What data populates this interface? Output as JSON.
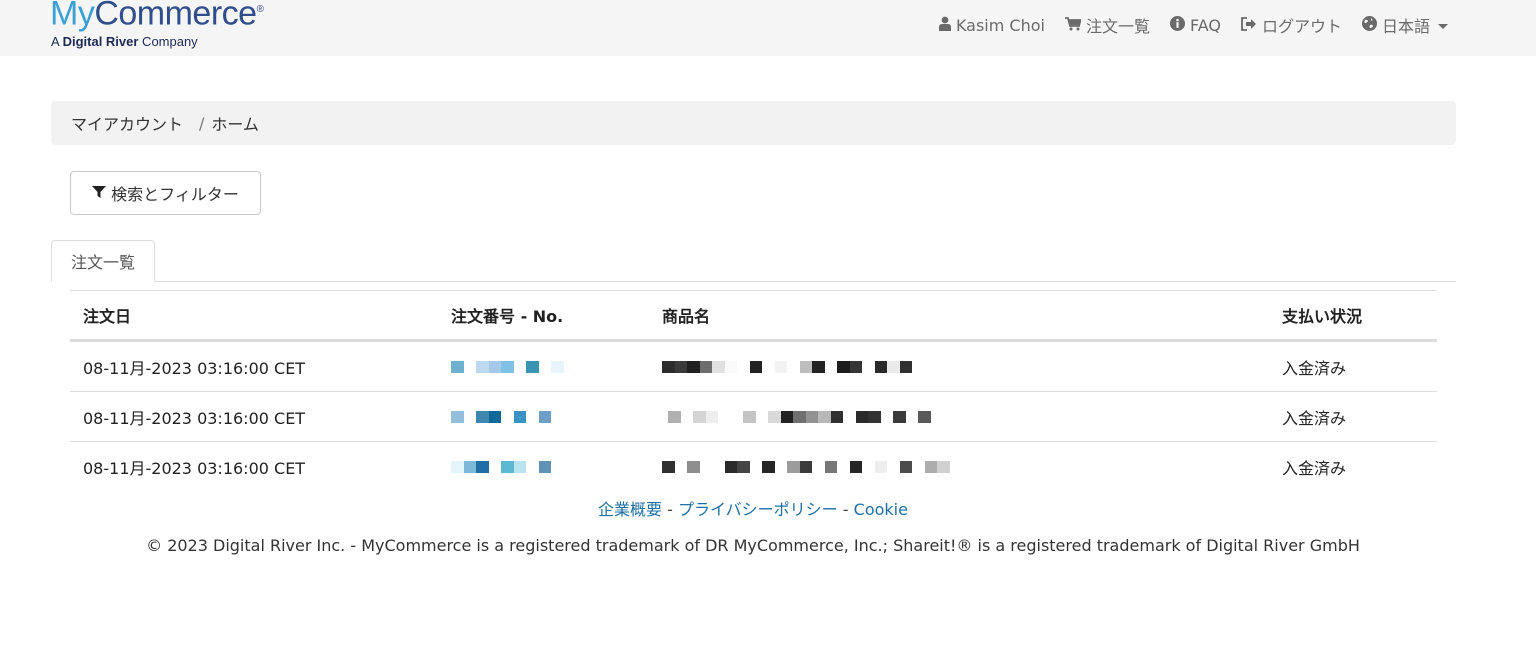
{
  "brand": {
    "logo_my": "My",
    "logo_commerce": "Commerce",
    "logo_reg": "®",
    "tagline_prefix": "A ",
    "tagline_bold": "Digital River",
    "tagline_suffix": " Company"
  },
  "nav": {
    "user": {
      "label": "Kasim Choi",
      "icon": "user-icon"
    },
    "orders": {
      "label": "注文一覧",
      "icon": "cart-icon"
    },
    "faq": {
      "label": "FAQ",
      "icon": "info-circle-icon"
    },
    "logout": {
      "label": "ログアウト",
      "icon": "sign-out-icon"
    },
    "language": {
      "label": "日本語",
      "icon": "globe-icon"
    }
  },
  "breadcrumb": {
    "parent": "マイアカウント",
    "separator": "/",
    "current": "ホーム"
  },
  "filter_button": {
    "label": "検索とフィルター",
    "icon": "filter-icon"
  },
  "tabs": [
    {
      "label": "注文一覧",
      "active": true
    }
  ],
  "table": {
    "headers": {
      "date": "注文日",
      "order_no": "注文番号 - No.",
      "product": "商品名",
      "payment": "支払い状況"
    },
    "rows": [
      {
        "date": "08-11月-2023 03:16:00 CET",
        "payment": "入金済み",
        "order_no_pixels": [
          "#6fb0cf",
          "#ffffff",
          "#bcd9ef",
          "#a6c9ea",
          "#7fc1e3",
          "#ffffff",
          "#3a95b2",
          "#ffffff",
          "#e8f4fb",
          "#ffffff"
        ],
        "product_pixels": [
          "#2c2c2c",
          "#3a3a3a",
          "#202020",
          "#6d6d6d",
          "#e1e1e1",
          "#fafafa",
          "#ffffff",
          "#222222",
          "#ffffff",
          "#f2f2f2",
          "#ffffff",
          "#bdbdbd",
          "#222222",
          "#ffffff",
          "#1d1d1d",
          "#353535",
          "#ffffff",
          "#2a2a2a",
          "#ebebeb",
          "#303030"
        ]
      },
      {
        "date": "08-11月-2023 03:16:00 CET",
        "payment": "入金済み",
        "order_no_pixels": [
          "#94bfdc",
          "#ffffff",
          "#3e88b0",
          "#0f6a9a",
          "#ffffff",
          "#3a93c2",
          "#ffffff",
          "#6f9fc7"
        ],
        "product_pixels": [
          "#b0b0b0",
          "#ffffff",
          "#d5d5d5",
          "#eeeeee",
          "#ffffff",
          "#ffffff",
          "#c4c4c4",
          "#ffffff",
          "#d9d9d9",
          "#222222",
          "#707070",
          "#929292",
          "#b8b8b8",
          "#303030",
          "#ffffff",
          "#2b2b2b",
          "#333333",
          "#ffffff",
          "#3a3a3a",
          "#ffffff",
          "#5a5a5a"
        ]
      },
      {
        "date": "08-11月-2023 03:16:00 CET",
        "payment": "入金済み",
        "order_no_pixels": [
          "#e3f4fb",
          "#7db8d8",
          "#1f6ea4",
          "#ffffff",
          "#5cb7d1",
          "#b9e4ef",
          "#ffffff",
          "#5f92b4"
        ],
        "product_pixels": [
          "#303030",
          "#ffffff",
          "#8d8d8d",
          "#ffffff",
          "#ffffff",
          "#2a2a2a",
          "#454545",
          "#ffffff",
          "#262626",
          "#ffffff",
          "#9c9c9c",
          "#3b3b3b",
          "#ffffff",
          "#777777",
          "#ffffff",
          "#262626",
          "#ffffff",
          "#eeeeee",
          "#ffffff",
          "#4c4c4c",
          "#ffffff",
          "#adadad",
          "#d0d0d0"
        ]
      }
    ]
  },
  "footer": {
    "link_company": "企業概要",
    "link_privacy": "プライバシーポリシー",
    "link_cookie": "Cookie",
    "dash": " - ",
    "copyright": "© 2023 Digital River Inc. - MyCommerce is a registered trademark of DR MyCommerce, Inc.; Shareit!® is a registered trademark of Digital River GmbH"
  },
  "colors": {
    "logo_light_blue": "#3aa0d6",
    "logo_dark_blue": "#2f4e8c",
    "link_blue": "#1d6fa5",
    "topbar_bg": "#f5f5f5",
    "breadcrumb_bg": "#f2f2f2"
  }
}
